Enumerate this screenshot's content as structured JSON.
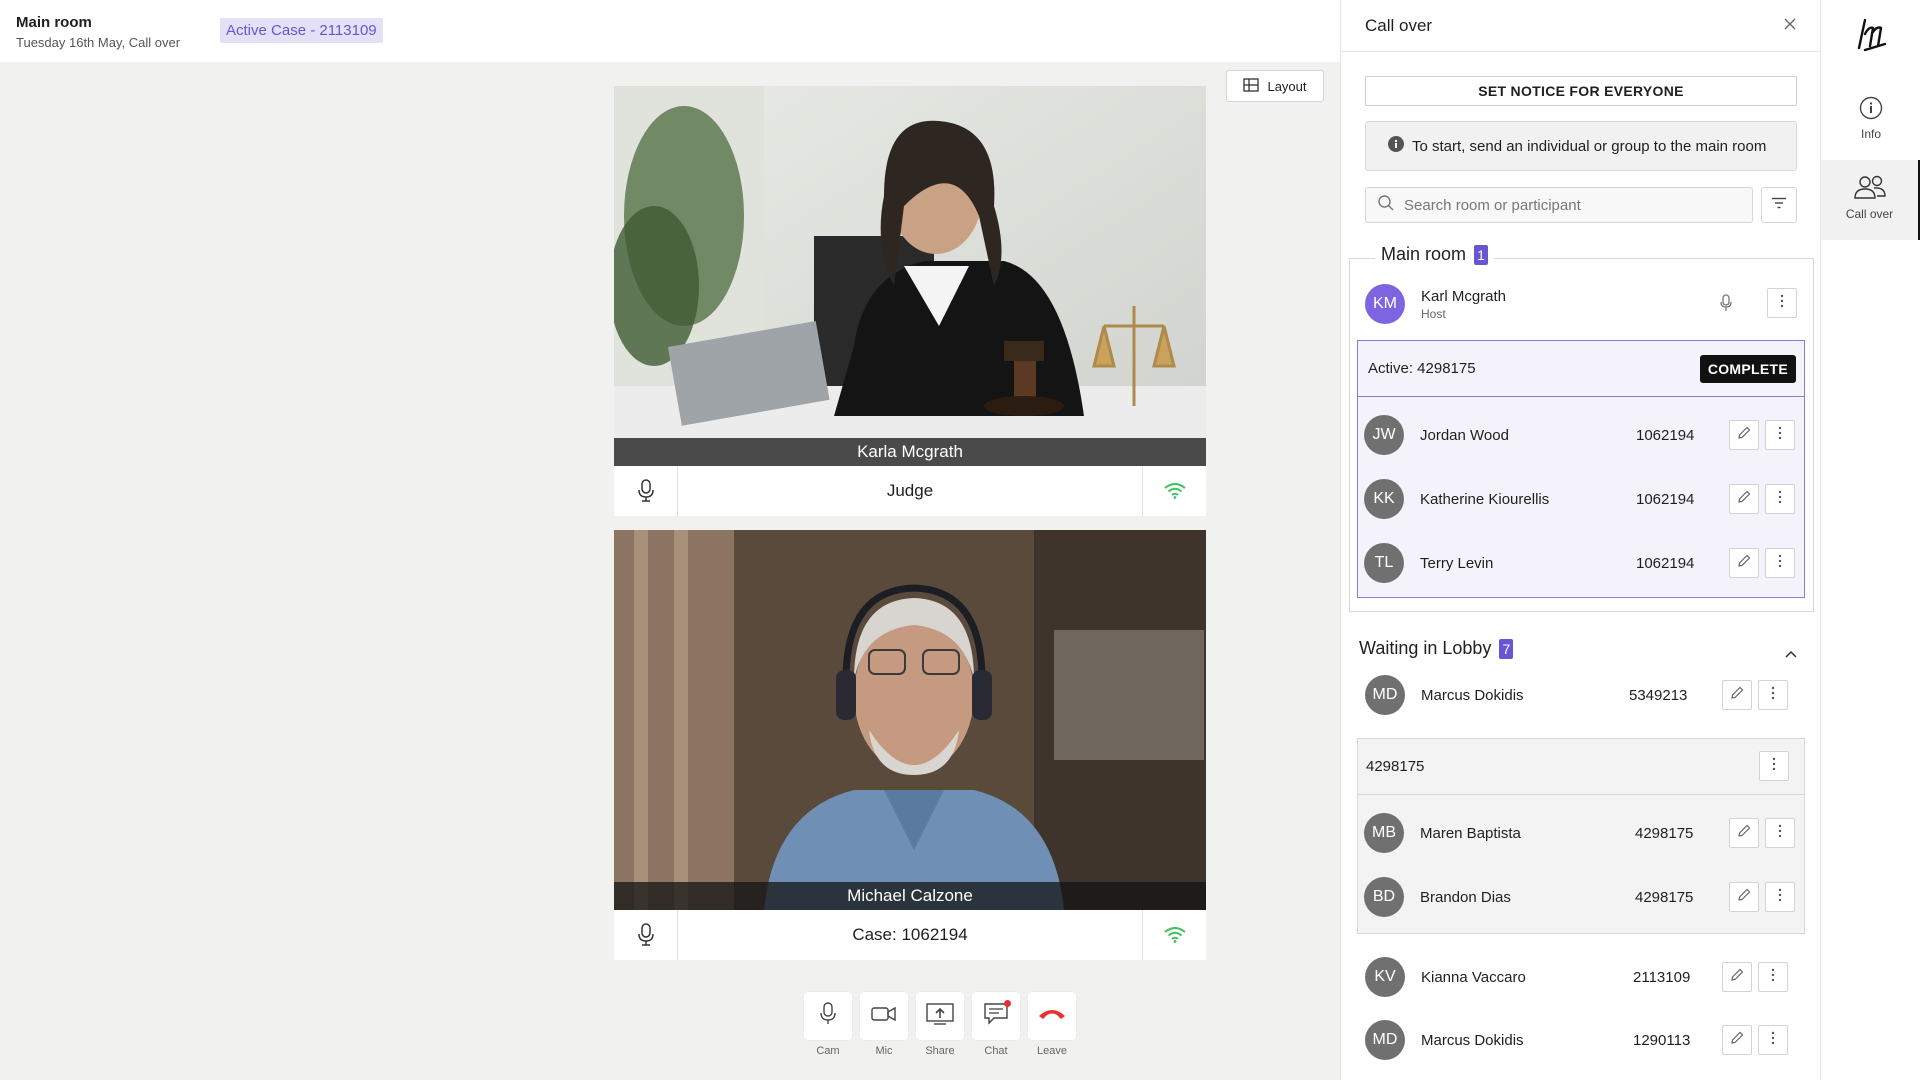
{
  "header": {
    "title": "Main room",
    "subtitle": "Tuesday 16th May, Call over",
    "active_case": "Active Case - 2113109"
  },
  "stage": {
    "layout_label": "Layout",
    "tiles": [
      {
        "caption": "Karla Mcgrath",
        "label": "Judge"
      },
      {
        "caption": "Michael Calzone",
        "label": "Case: 1062194"
      }
    ]
  },
  "controls": [
    {
      "label": "Cam",
      "icon": "mic-icon"
    },
    {
      "label": "Mic",
      "icon": "camera-icon"
    },
    {
      "label": "Share",
      "icon": "share-icon"
    },
    {
      "label": "Chat",
      "icon": "chat-icon"
    },
    {
      "label": "Leave",
      "icon": "hangup-icon"
    }
  ],
  "panel": {
    "title": "Call over",
    "notice_button": "SET NOTICE FOR EVERYONE",
    "info_text": "To start, send an individual or group to the main room",
    "search_placeholder": "Search room or participant",
    "main_room": {
      "title": "Main room",
      "count": "1",
      "host": {
        "initials": "KM",
        "name": "Karl Mcgrath",
        "role": "Host"
      },
      "active_group": {
        "label": "Active: 4298175",
        "complete_label": "COMPLETE",
        "members": [
          {
            "initials": "JW",
            "name": "Jordan Wood",
            "number": "1062194"
          },
          {
            "initials": "KK",
            "name": "Katherine Kiourellis",
            "number": "1062194"
          },
          {
            "initials": "TL",
            "name": "Terry Levin",
            "number": "1062194"
          }
        ]
      }
    },
    "lobby": {
      "title": "Waiting in Lobby",
      "count": "7",
      "first": {
        "initials": "MD",
        "name": "Marcus Dokidis",
        "number": "5349213"
      },
      "group": {
        "label": "4298175",
        "members": [
          {
            "initials": "MB",
            "name": "Maren Baptista",
            "number": "4298175"
          },
          {
            "initials": "BD",
            "name": "Brandon Dias",
            "number": "4298175"
          }
        ]
      },
      "others": [
        {
          "initials": "KV",
          "name": "Kianna Vaccaro",
          "number": "2113109"
        },
        {
          "initials": "MD",
          "name": "Marcus Dokidis",
          "number": "1290113"
        }
      ]
    }
  },
  "rail": {
    "logo": "lm",
    "items": [
      {
        "label": "Info",
        "icon": "info-icon"
      },
      {
        "label": "Call over",
        "icon": "users-icon"
      }
    ]
  },
  "colors": {
    "accent": "#6a55d0",
    "leave": "#e5312f",
    "signal": "#3cc35a"
  }
}
